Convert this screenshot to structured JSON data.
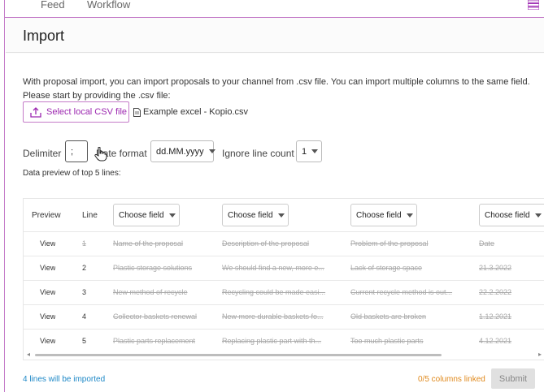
{
  "nav": {
    "tabs": [
      "Feed",
      "Workflow"
    ],
    "menu_icon": "list-layout-icon"
  },
  "page": {
    "title": "Import"
  },
  "intro": {
    "text": "With proposal import, you can import proposals to your channel from .csv file. You can import multiple columns to the same field. Please start by providing the .csv file:"
  },
  "upload": {
    "button_label": "Select local CSV file",
    "icon": "upload-icon",
    "example_label": "Example excel - Kopio.csv",
    "example_icon": "file-icon"
  },
  "options": {
    "delimiter_label": "Delimiter",
    "delimiter_value": ";",
    "date_format_label": "Date format",
    "date_format_value": "dd.MM.yyyy",
    "ignore_label": "Ignore line count",
    "ignore_value": "1"
  },
  "preview": {
    "label": "Data preview of top 5 lines:",
    "headers": {
      "preview": "Preview",
      "line": "Line",
      "field_placeholder": "Choose field"
    },
    "rows": [
      {
        "view": "View",
        "line": "1",
        "c1": "Name of the proposal",
        "c2": "Description of the proposal",
        "c3": "Problem of the proposal",
        "c4": "Date",
        "line_struck": true
      },
      {
        "view": "View",
        "line": "2",
        "c1": "Plastic storage solutions",
        "c2": "We should find a new, more e...",
        "c3": "Lack of storage space",
        "c4": "21.3.2022",
        "line_struck": false
      },
      {
        "view": "View",
        "line": "3",
        "c1": "New method of recycle",
        "c2": "Recycling could be made easi...",
        "c3": "Current recycle method is out...",
        "c4": "22.2.2022",
        "line_struck": false
      },
      {
        "view": "View",
        "line": "4",
        "c1": "Collector baskets renewal",
        "c2": "New more durable baskets fo...",
        "c3": "Old baskets are broken",
        "c4": "1.12.2021",
        "line_struck": false
      },
      {
        "view": "View",
        "line": "5",
        "c1": "Plastic parts replacement",
        "c2": "Replacing plastic part with th...",
        "c3": "Too much plastic parts",
        "c4": "4.12.2021",
        "line_struck": false
      }
    ]
  },
  "footer": {
    "lines_info": "4 lines will be imported",
    "columns_info": "0/5 columns linked",
    "submit_label": "Submit"
  },
  "colors": {
    "accent": "#9c27b0",
    "info_blue": "#1e88c7",
    "warning_orange": "#e08a1e"
  }
}
